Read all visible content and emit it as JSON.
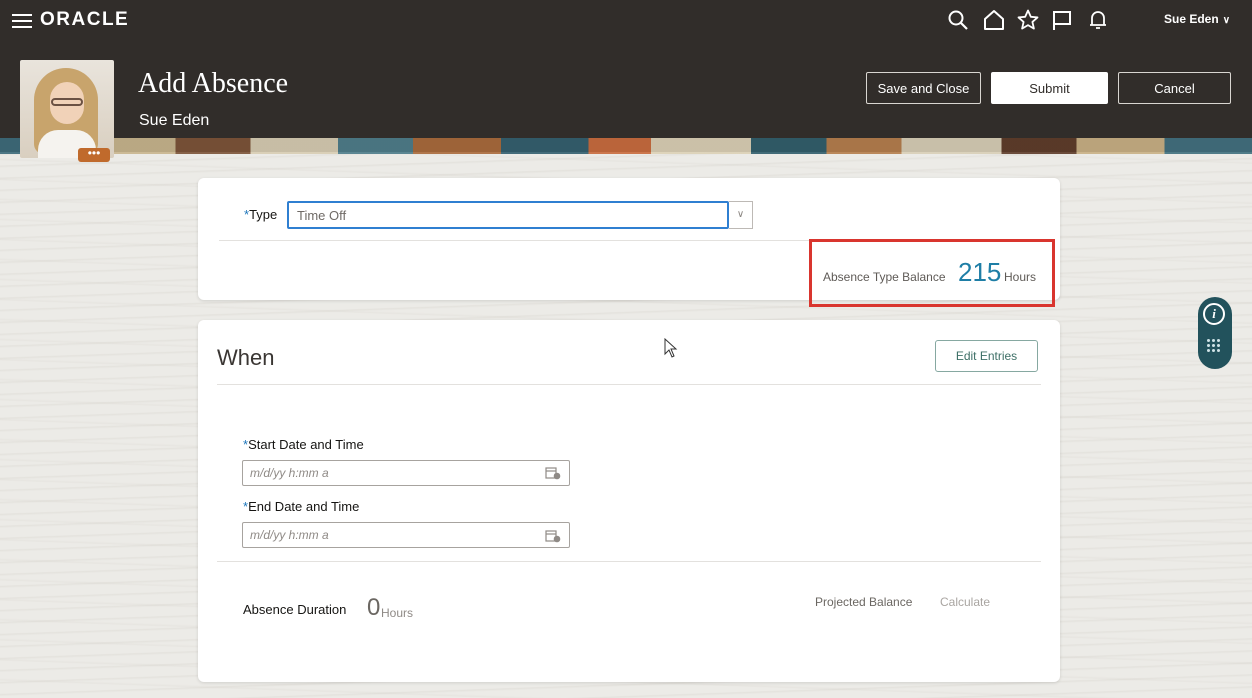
{
  "topbar": {
    "logo": "ORACLE",
    "icons": [
      "menu-icon",
      "search-icon",
      "home-icon",
      "star-icon",
      "flag-icon",
      "bell-icon"
    ],
    "user_name": "Sue Eden",
    "user_chevron": "∨"
  },
  "header": {
    "title": "Add Absence",
    "subtitle": "Sue Eden",
    "avatar_more": "•••",
    "buttons": {
      "save_close": "Save and Close",
      "submit": "Submit",
      "cancel": "Cancel"
    }
  },
  "type_card": {
    "required_mark": "*",
    "type_label": "Type",
    "type_value": "Time Off",
    "balance_label": "Absence Type Balance",
    "balance_value": "215",
    "balance_unit": "Hours"
  },
  "when_card": {
    "title": "When",
    "edit_button": "Edit Entries",
    "required_mark": "*",
    "start_label": "Start Date and Time",
    "start_placeholder": "m/d/yy h:mm a",
    "end_label": "End Date and Time",
    "end_placeholder": "m/d/yy h:mm a",
    "duration_label": "Absence Duration",
    "duration_value": "0",
    "duration_unit": "Hours",
    "projected_label": "Projected Balance",
    "calculate_link": "Calculate"
  },
  "side_widget": {
    "info_label": "i"
  },
  "colors": {
    "header_bg": "#312d2a",
    "accent_blue": "#1e7ea6",
    "highlight_red": "#d9352e",
    "widget_teal": "#22525c"
  }
}
